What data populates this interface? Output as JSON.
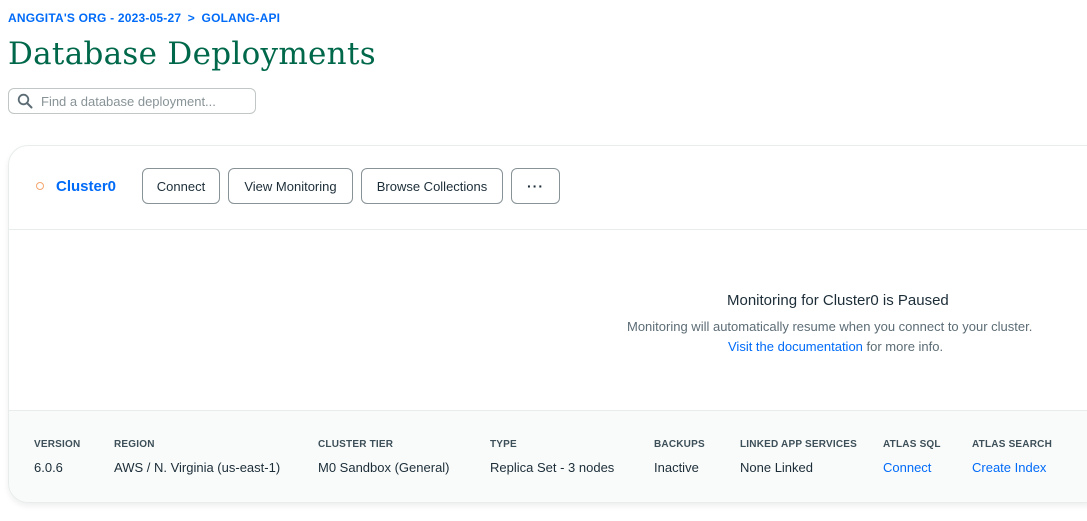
{
  "breadcrumb": {
    "org_project": "ANGGITA'S ORG - 2023-05-27",
    "separator": ">",
    "current": "GOLANG-API"
  },
  "page": {
    "title": "Database Deployments"
  },
  "search": {
    "placeholder": "Find a database deployment...",
    "value": ""
  },
  "cluster": {
    "name": "Cluster0",
    "status_color": "#f5a66d",
    "buttons": {
      "connect": "Connect",
      "view_monitoring": "View Monitoring",
      "browse_collections": "Browse Collections",
      "more": "···"
    },
    "monitoring": {
      "title": "Monitoring for Cluster0 is Paused",
      "subtitle": "Monitoring will automatically resume when you connect to your cluster.",
      "doc_link": "Visit the documentation",
      "doc_suffix": " for more info."
    },
    "details": [
      {
        "label": "VERSION",
        "value": "6.0.6"
      },
      {
        "label": "REGION",
        "value": "AWS / N. Virginia (us-east-1)"
      },
      {
        "label": "CLUSTER TIER",
        "value": "M0 Sandbox (General)"
      },
      {
        "label": "TYPE",
        "value": "Replica Set - 3 nodes"
      },
      {
        "label": "BACKUPS",
        "value": "Inactive"
      },
      {
        "label": "LINKED APP SERVICES",
        "value": "None Linked"
      },
      {
        "label": "ATLAS SQL",
        "value": "Connect"
      },
      {
        "label": "ATLAS SEARCH",
        "value": "Create Index"
      }
    ]
  },
  "colors": {
    "link": "#016bf8",
    "title": "#00684a"
  },
  "icons": {
    "search": "search-icon",
    "status": "status-dot-icon",
    "more": "ellipsis-icon"
  }
}
